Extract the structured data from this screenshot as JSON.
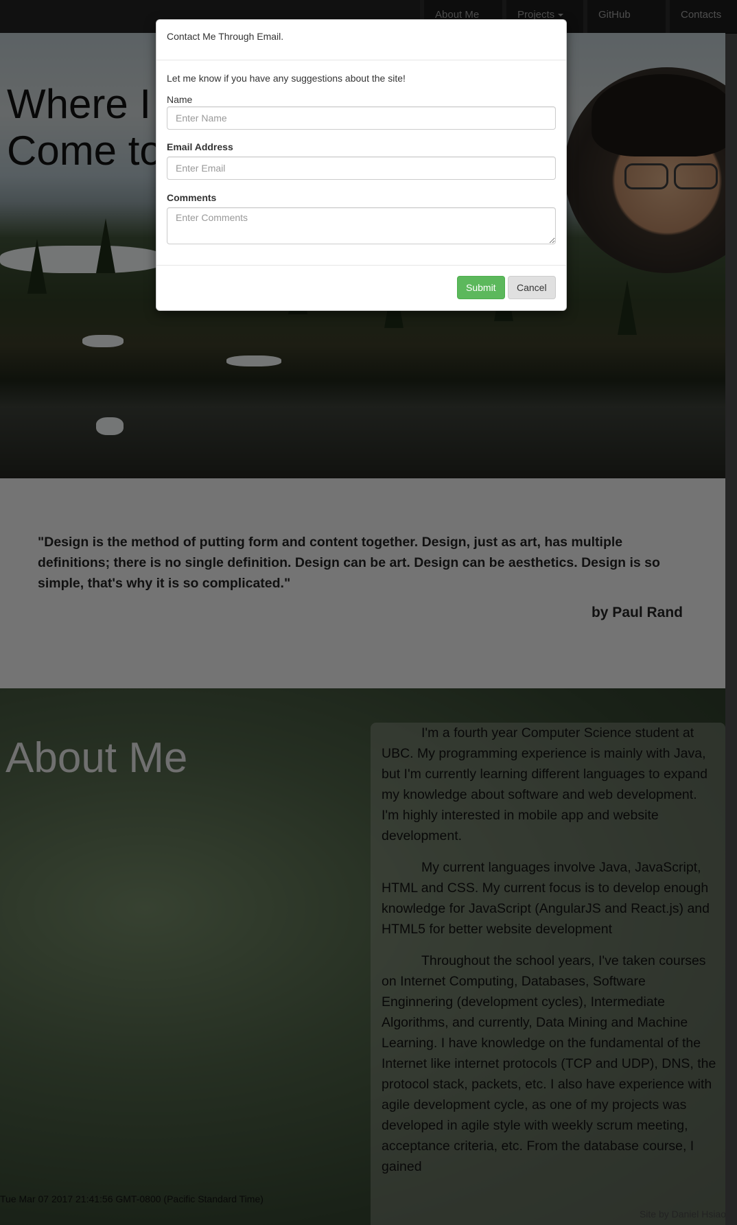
{
  "navbar": {
    "items": [
      {
        "label": "About Me"
      },
      {
        "label": "Projects"
      },
      {
        "label": "GitHub"
      },
      {
        "label": "Contacts"
      }
    ]
  },
  "hero": {
    "title_line1": "Where I",
    "title_line2": "Come to"
  },
  "quote": {
    "text": "\"Design is the method of putting form and content together. Design, just as art, has multiple definitions; there is no single definition. Design can be art. Design can be aesthetics. Design is so simple, that's why it is so complicated.\"",
    "author": "by Paul Rand"
  },
  "about": {
    "title": "About Me",
    "paragraphs": [
      "I'm a fourth year Computer Science student at UBC. My programming experience is mainly with Java, but I'm currently learning different languages to expand my knowledge about software and web development. I'm highly interested in mobile app and website development.",
      "My current languages involve Java, JavaScript, HTML and CSS. My current focus is to develop enough knowledge for JavaScript (AngularJS and React.js) and HTML5 for better website development",
      "Throughout the school years, I've taken courses on Internet Computing, Databases, Software Enginnering (development cycles), Intermediate Algorithms, and currently, Data Mining and Machine Learning. I have knowledge on the fundamental of the Internet like internet protocols (TCP and UDP), DNS, the protocol stack, packets, etc. I also have experience with agile development cycle, as one of my projects was developed in agile style with weekly scrum meeting, acceptance criteria, etc. From the database course, I gained"
    ]
  },
  "footer": {
    "timestamp": "Tue Mar 07 2017 21:41:56 GMT-0800 (Pacific Standard Time)",
    "credit": "Site by Daniel Hsiao"
  },
  "modal": {
    "title": "Contact Me Through Email.",
    "intro": "Let me know if you have any suggestions about the site!",
    "name_label": "Name",
    "name_placeholder": "Enter Name",
    "email_label": "Email Address",
    "email_placeholder": "Enter Email",
    "comments_label": "Comments",
    "comments_placeholder": "Enter Comments",
    "submit_label": "Submit",
    "cancel_label": "Cancel"
  }
}
